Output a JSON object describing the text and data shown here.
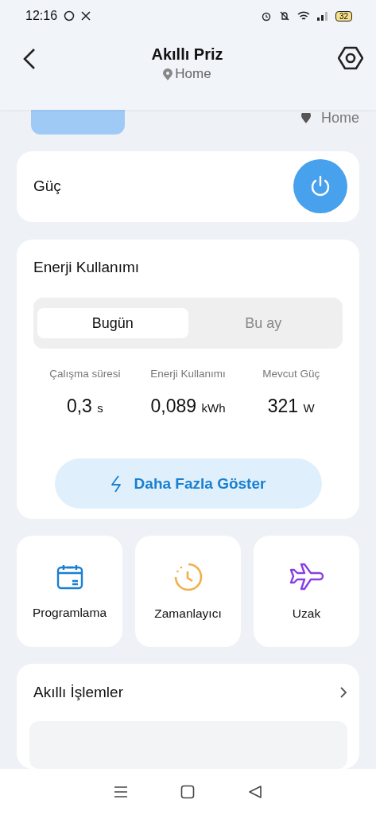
{
  "status_bar": {
    "time": "12:16",
    "battery": "32"
  },
  "header": {
    "title": "Akıllı Priz",
    "location": "Home"
  },
  "device": {
    "location": "Home"
  },
  "power": {
    "label": "Güç",
    "on": true
  },
  "energy": {
    "title": "Enerji Kullanımı",
    "tabs": [
      {
        "label": "Bugün",
        "selected": true
      },
      {
        "label": "Bu ay",
        "selected": false
      }
    ],
    "stats": [
      {
        "label": "Çalışma süresi",
        "value": "0,3",
        "unit": "s"
      },
      {
        "label": "Enerji Kullanımı",
        "value": "0,089",
        "unit": "kWh"
      },
      {
        "label": "Mevcut Güç",
        "value": "321",
        "unit": "W"
      }
    ],
    "button": "Daha Fazla Göster"
  },
  "features": [
    {
      "label": "Programlama",
      "kind": "calendar"
    },
    {
      "label": "Zamanlayıcı",
      "kind": "clock"
    },
    {
      "label": "Uzak",
      "kind": "plane"
    }
  ],
  "smart_actions": {
    "title": "Akıllı İşlemler"
  }
}
